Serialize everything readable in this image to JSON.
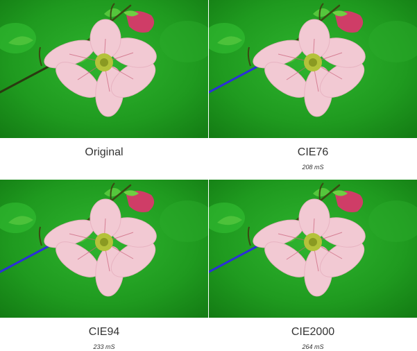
{
  "panels": [
    {
      "caption": "Original",
      "timing": "",
      "stem_color": "#2a3a10"
    },
    {
      "caption": "CIE76",
      "timing": "208 mS",
      "stem_color": "#2b2fd8"
    },
    {
      "caption": "CIE94",
      "timing": "233 mS",
      "stem_color": "#2b2fd8"
    },
    {
      "caption": "CIE2000",
      "timing": "264 mS",
      "stem_color": "#2b2fd8"
    }
  ],
  "colors": {
    "background_green": "#1f9a1f",
    "petal_pink": "#f2c9d3",
    "petal_vein": "#c9617a",
    "bud_magenta": "#cf3d67",
    "flower_center": "#b4c23a"
  }
}
